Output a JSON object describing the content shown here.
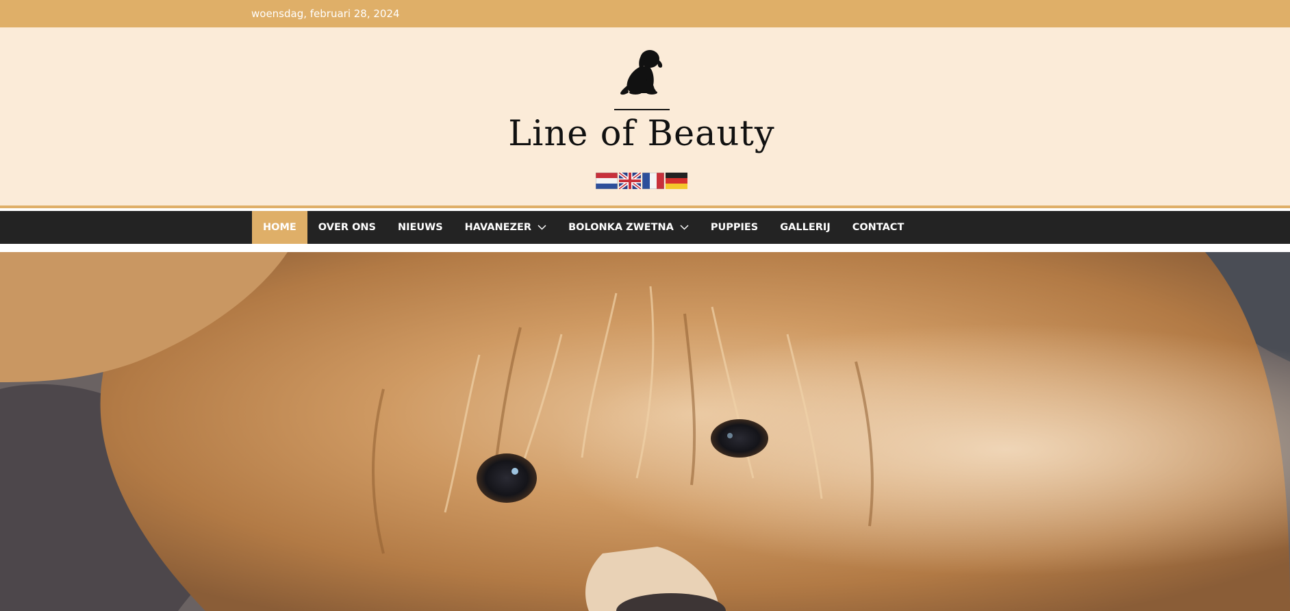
{
  "topbar": {
    "date": "woensdag, februari 28, 2024"
  },
  "header": {
    "logo_icon": "dog-silhouette-icon",
    "site_title": "Line of Beauty",
    "flags": [
      {
        "name": "flag-nl-icon",
        "lang": "Nederlands"
      },
      {
        "name": "flag-uk-icon",
        "lang": "English"
      },
      {
        "name": "flag-fr-icon",
        "lang": "Français"
      },
      {
        "name": "flag-de-icon",
        "lang": "Deutsch"
      }
    ]
  },
  "nav": {
    "items": [
      {
        "label": "HOME",
        "active": true,
        "dropdown": false
      },
      {
        "label": "OVER ONS",
        "active": false,
        "dropdown": false
      },
      {
        "label": "NIEUWS",
        "active": false,
        "dropdown": false
      },
      {
        "label": "HAVANEZER",
        "active": false,
        "dropdown": true
      },
      {
        "label": "BOLONKA ZWETNA",
        "active": false,
        "dropdown": true
      },
      {
        "label": "PUPPIES",
        "active": false,
        "dropdown": false
      },
      {
        "label": "GALLERIJ",
        "active": false,
        "dropdown": false
      },
      {
        "label": "CONTACT",
        "active": false,
        "dropdown": false
      }
    ]
  },
  "hero": {
    "image": "close-up of fluffy golden dog lying on dark blanket"
  },
  "colors": {
    "accent": "#dfaf68",
    "header_bg": "#fbebd8",
    "nav_bg": "#232323",
    "text_dark": "#111111"
  }
}
